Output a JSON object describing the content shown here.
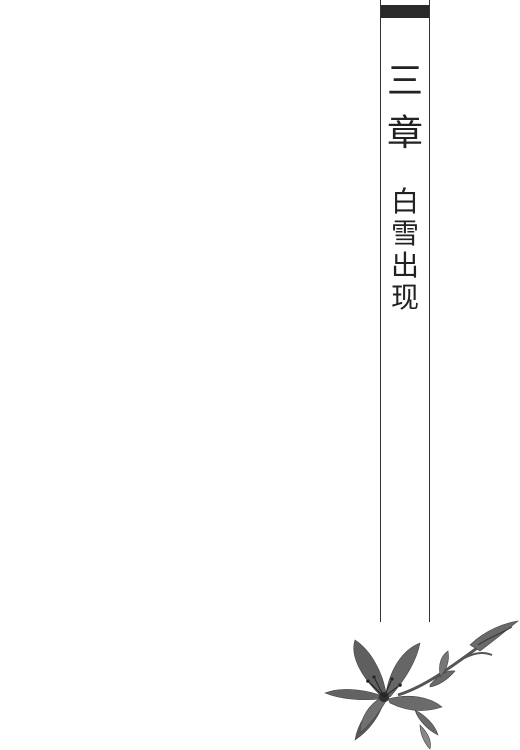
{
  "chapter": {
    "number_chars": [
      "三",
      "章"
    ]
  },
  "title": {
    "chars": [
      "白",
      "雪",
      "出",
      "现"
    ]
  },
  "decoration": {
    "icon": "lily-flower-illustration",
    "color": "#5a5a5a"
  }
}
